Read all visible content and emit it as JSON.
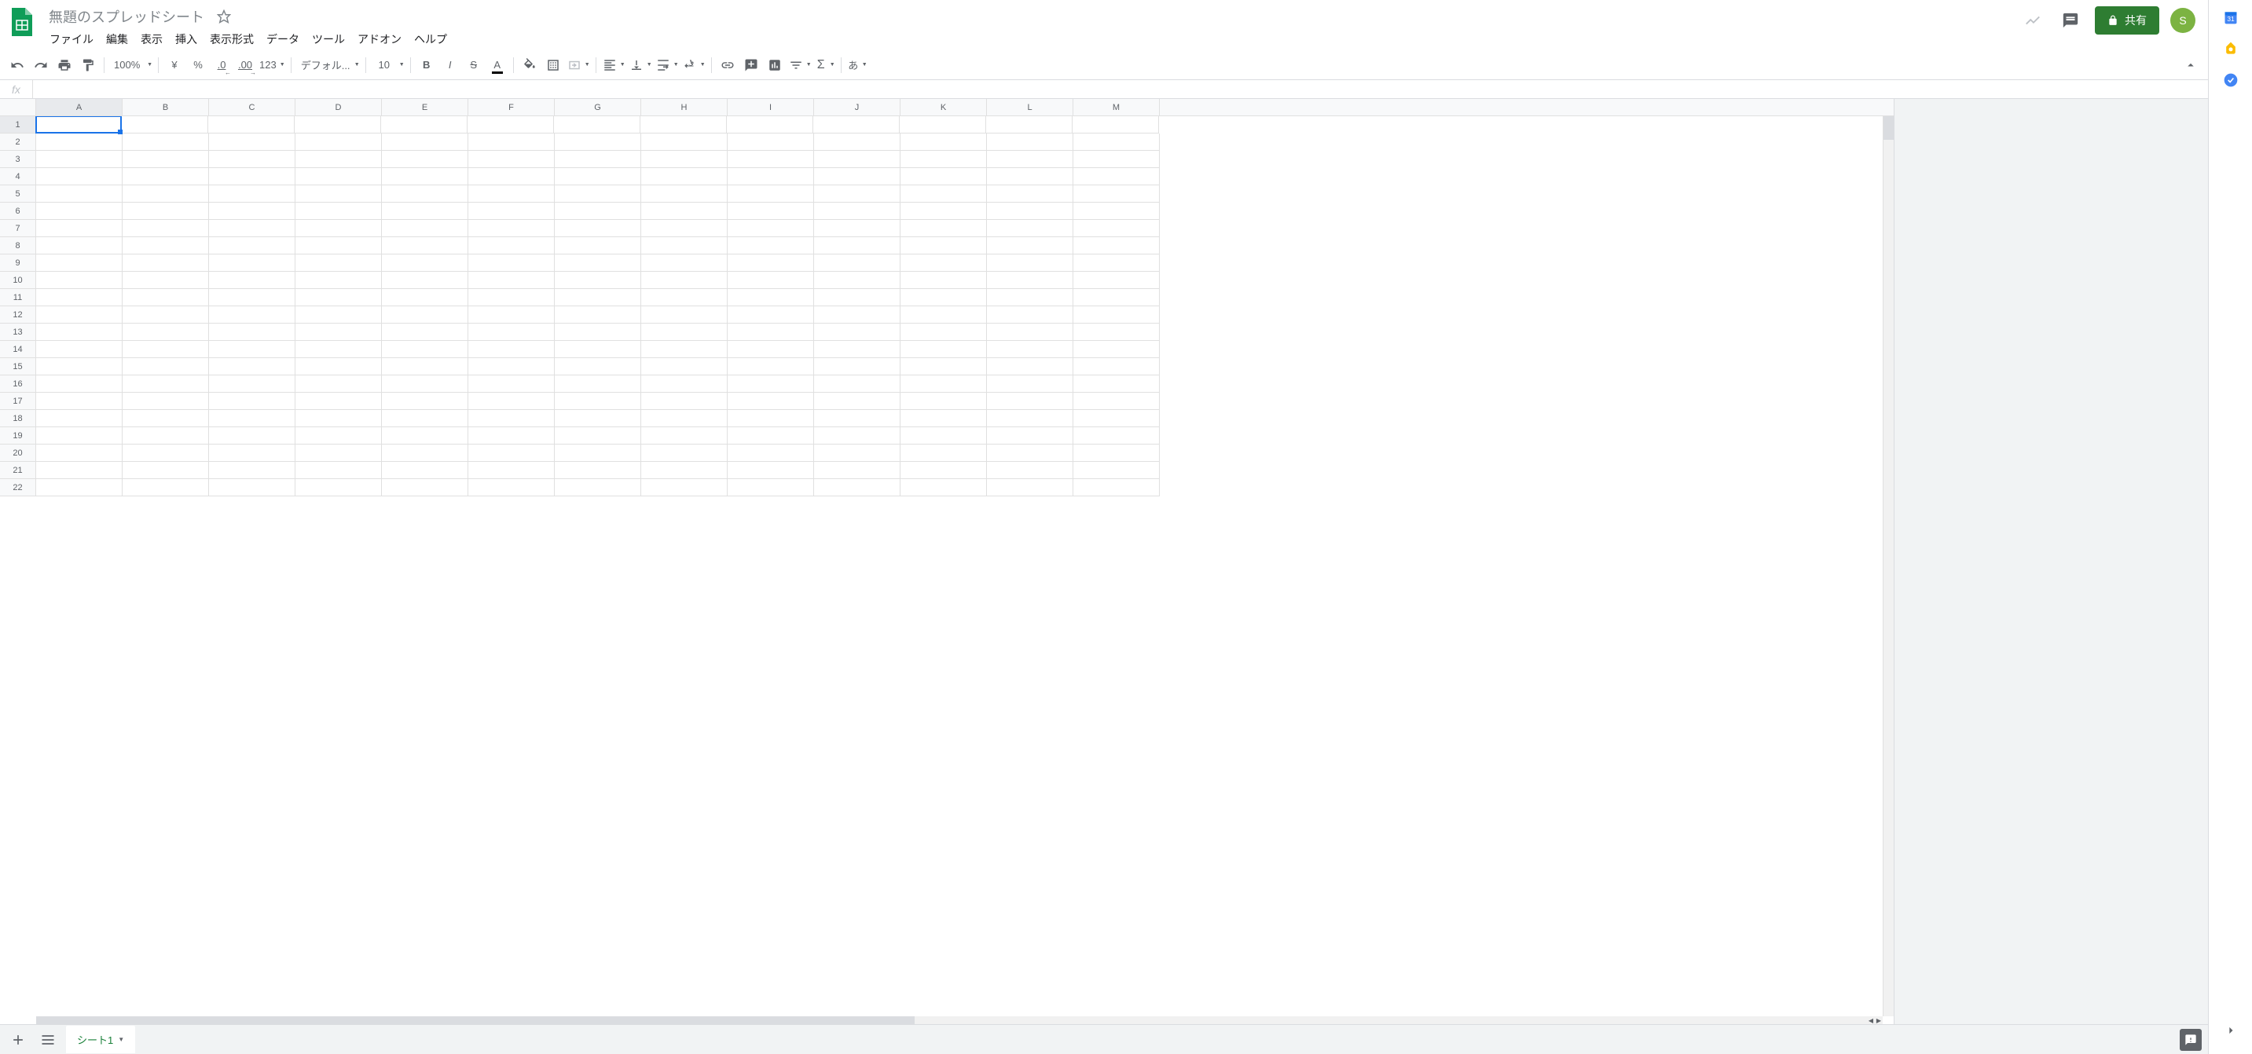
{
  "doc": {
    "title": "無題のスプレッドシート"
  },
  "menu": {
    "file": "ファイル",
    "edit": "編集",
    "view": "表示",
    "insert": "挿入",
    "format": "表示形式",
    "data": "データ",
    "tools": "ツール",
    "addons": "アドオン",
    "help": "ヘルプ"
  },
  "toolbar": {
    "zoom": "100%",
    "currency": "¥",
    "percent": "%",
    "dec_minus": ".0",
    "dec_plus": ".00",
    "more_formats": "123",
    "font": "デフォル...",
    "font_size": "10",
    "ime": "あ"
  },
  "share": {
    "label": "共有"
  },
  "avatar": {
    "initial": "S"
  },
  "fx": {
    "label": "fx",
    "value": ""
  },
  "columns": [
    "A",
    "B",
    "C",
    "D",
    "E",
    "F",
    "G",
    "H",
    "I",
    "J",
    "K",
    "L",
    "M"
  ],
  "rows": [
    "1",
    "2",
    "3",
    "4",
    "5",
    "6",
    "7",
    "8",
    "9",
    "10",
    "11",
    "12",
    "13",
    "14",
    "15",
    "16",
    "17",
    "18",
    "19",
    "20",
    "21",
    "22"
  ],
  "active_cell": {
    "row": 0,
    "col": 0
  },
  "sheet_tab": {
    "name": "シート1"
  }
}
